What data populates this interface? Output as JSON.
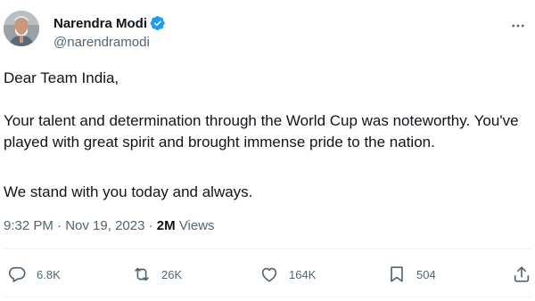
{
  "author": {
    "display_name": "Narendra Modi",
    "handle": "@narendramodi",
    "verified_badge_color": "#1d9bf0"
  },
  "tweet": {
    "paragraphs": [
      "Dear Team India,",
      "Your talent and determination through the World Cup was noteworthy. You've played with great spirit and brought immense pride to the nation.",
      "We stand with you today and always."
    ],
    "time": "9:32 PM",
    "date": "Nov 19, 2023",
    "separator": " · ",
    "views_count": "2M",
    "views_label": "Views"
  },
  "actions": {
    "reply_count": "6.8K",
    "retweet_count": "26K",
    "like_count": "164K",
    "bookmark_count": "504"
  },
  "icons": {
    "more": "more-horizontal-icon",
    "reply": "reply-icon",
    "retweet": "retweet-icon",
    "like": "heart-icon",
    "bookmark": "bookmark-icon",
    "share": "share-icon"
  },
  "colors": {
    "text_primary": "#0f1419",
    "text_secondary": "#536471",
    "divider": "#eff3f4"
  }
}
